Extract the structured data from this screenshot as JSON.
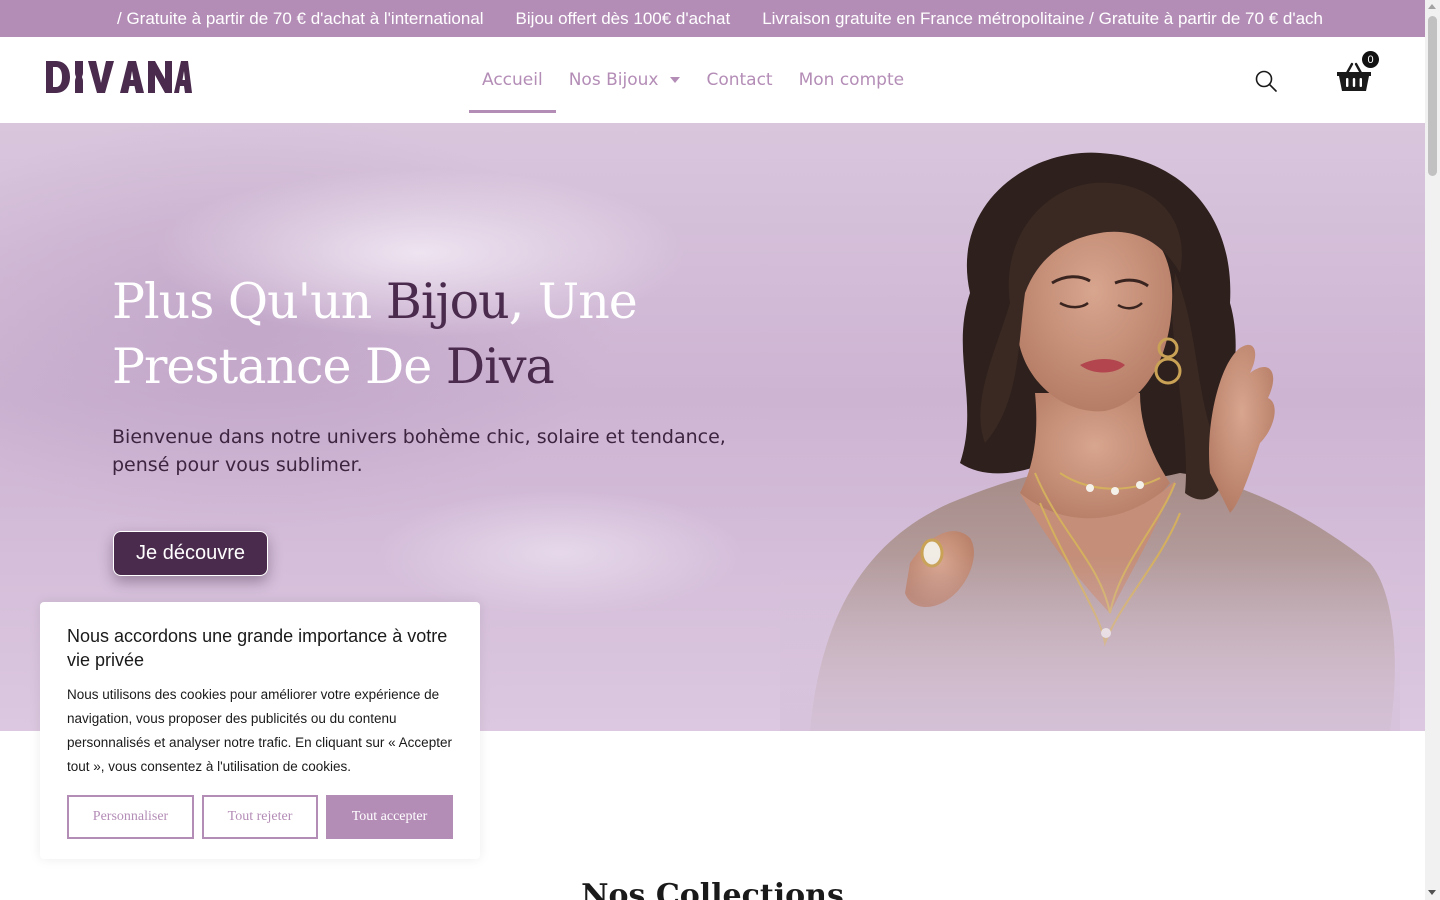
{
  "announcement": {
    "items": [
      "/ Gratuite à partir de 70 € d'achat à l'international",
      "Bijou offert dès 100€ d'achat",
      "Livraison gratuite en France métropolitaine / Gratuite à partir de 70 € d'ach"
    ]
  },
  "header": {
    "logo_text": "DIVANA",
    "nav": [
      {
        "label": "Accueil",
        "active": true
      },
      {
        "label": "Nos Bijoux",
        "has_dropdown": true
      },
      {
        "label": "Contact"
      },
      {
        "label": "Mon compte"
      }
    ],
    "search_icon": "search-icon",
    "cart_icon": "basket-icon",
    "cart_count": "0"
  },
  "hero": {
    "title_part1": "Plus Qu'un ",
    "title_accent1": "Bijou",
    "title_part2": ", Une Prestance De ",
    "title_accent2": "Diva",
    "subtitle": "Bienvenue dans notre univers bohème chic, solaire et tendance, pensé pour vous sublimer.",
    "cta_label": "Je découvre"
  },
  "collections": {
    "title": "Nos Collections"
  },
  "cookie_banner": {
    "title": "Nous accordons une grande importance à votre vie privée",
    "text": "Nous utilisons des cookies pour améliorer votre expérience de navigation, vous proposer des publicités ou du contenu personnalisés et analyser notre trafic. En cliquant sur « Accepter tout », vous consentez à l'utilisation de cookies.",
    "buttons": {
      "customize": "Personnaliser",
      "reject": "Tout rejeter",
      "accept": "Tout accepter"
    }
  },
  "colors": {
    "brand_lilac": "#b48db7",
    "brand_plum": "#4a2a4d",
    "hero_bg": "#d4bfd8"
  }
}
